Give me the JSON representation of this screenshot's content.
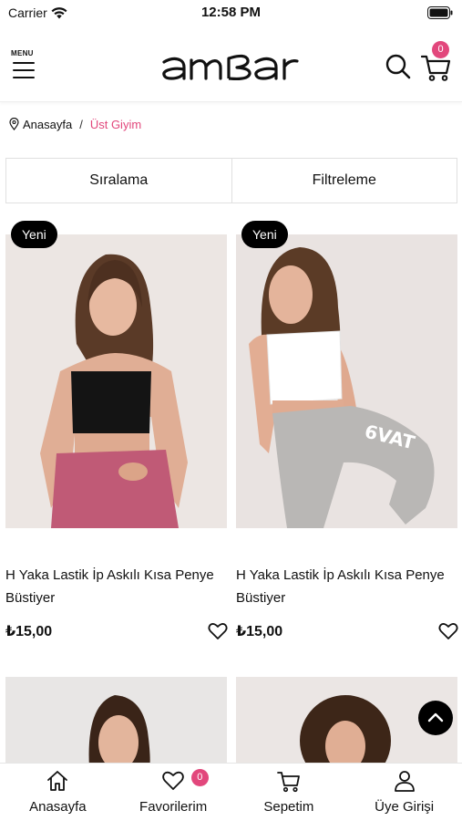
{
  "status_bar": {
    "carrier": "Carrier",
    "time": "12:58 PM"
  },
  "header": {
    "menu_label": "MENU",
    "brand": "ambar",
    "cart_count": "0"
  },
  "breadcrumb": {
    "home": "Anasayfa",
    "separator": "/",
    "current": "Üst Giyim"
  },
  "toolbar": {
    "sort_label": "Sıralama",
    "filter_label": "Filtreleme"
  },
  "products": [
    {
      "badge": "Yeni",
      "title": "H Yaka Lastik İp Askılı Kısa Penye Büstiyer",
      "price": "₺15,00",
      "top_color": "#111111",
      "bottom_color": "#c05a76"
    },
    {
      "badge": "Yeni",
      "title": "H Yaka Lastik İp Askılı Kısa Penye Büstiyer",
      "price": "₺15,00",
      "top_color": "#ffffff",
      "bottom_color": "#b8b6b4"
    }
  ],
  "bottom_nav": {
    "items": [
      {
        "label": "Anasayfa",
        "icon": "home-icon"
      },
      {
        "label": "Favorilerim",
        "icon": "heart-icon"
      },
      {
        "label": "Sepetim",
        "icon": "cart-icon"
      },
      {
        "label": "Üye Girişi",
        "icon": "user-icon"
      }
    ],
    "favorites_count": "0"
  },
  "colors": {
    "accent": "#e2477c",
    "badge_bg": "#000000",
    "image_bg": "#e9e3e1"
  }
}
